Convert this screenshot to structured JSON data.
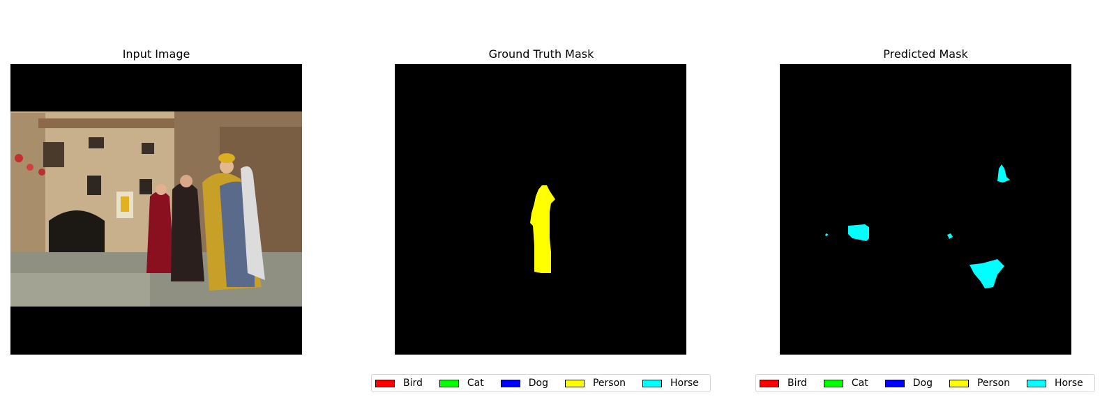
{
  "panels": [
    {
      "title": "Input Image"
    },
    {
      "title": "Ground Truth Mask"
    },
    {
      "title": "Predicted Mask"
    }
  ],
  "legend": {
    "items": [
      {
        "label": "Bird",
        "color": "#ff0000"
      },
      {
        "label": "Cat",
        "color": "#00ff00"
      },
      {
        "label": "Dog",
        "color": "#0000ff"
      },
      {
        "label": "Person",
        "color": "#ffff00"
      },
      {
        "label": "Horse",
        "color": "#00ffff"
      }
    ]
  },
  "colors": {
    "mask_background": "#000000",
    "person": "#ffff00",
    "horse": "#00ffff"
  }
}
